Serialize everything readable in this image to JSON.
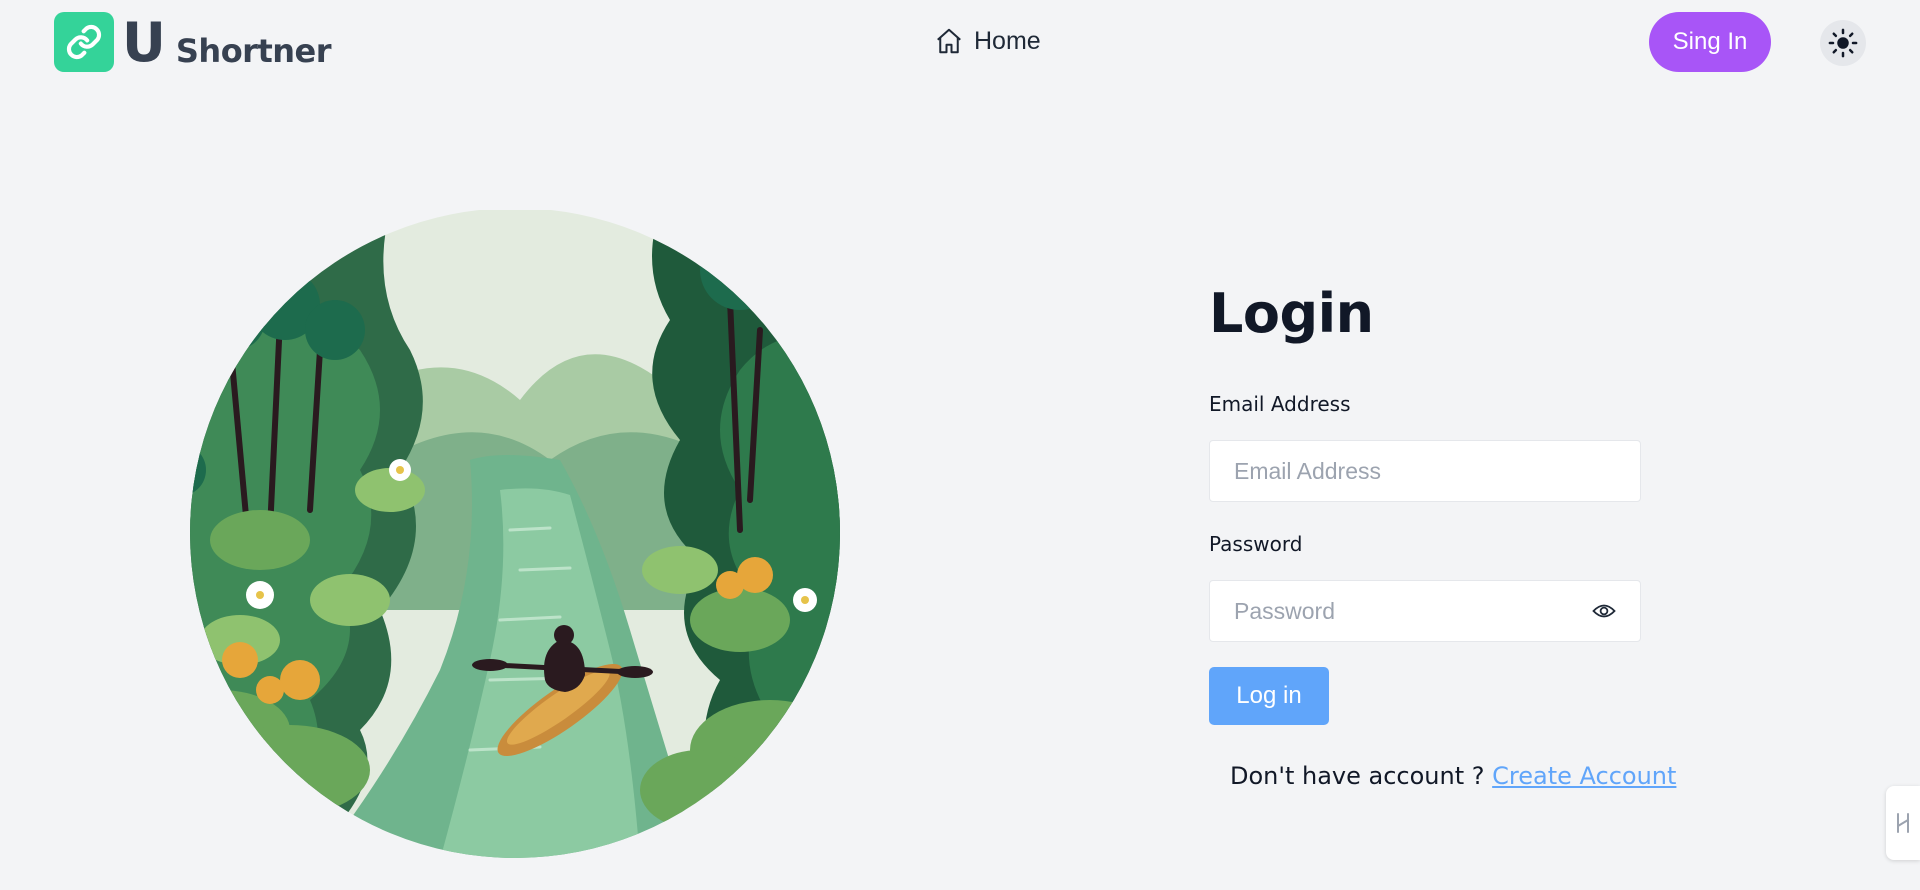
{
  "brand": {
    "letter": "U",
    "word": "Shortner",
    "icon": "link-icon",
    "badge_color": "#34d399"
  },
  "nav": {
    "home_label": "Home",
    "home_icon": "home-icon"
  },
  "header": {
    "signin_label": "Sing In",
    "signin_color": "#a855f7",
    "theme_icon": "sun-icon"
  },
  "login": {
    "title": "Login",
    "email_label": "Email Address",
    "email_placeholder": "Email Address",
    "email_value": "",
    "password_label": "Password",
    "password_placeholder": "Password",
    "password_value": "",
    "password_toggle_icon": "eye-icon",
    "submit_label": "Log in",
    "submit_color": "#60a5fa",
    "signup_prompt": "Don't have account ? ",
    "signup_link": "Create Account"
  },
  "illustration": {
    "icon": "river-kayak-illustration"
  }
}
